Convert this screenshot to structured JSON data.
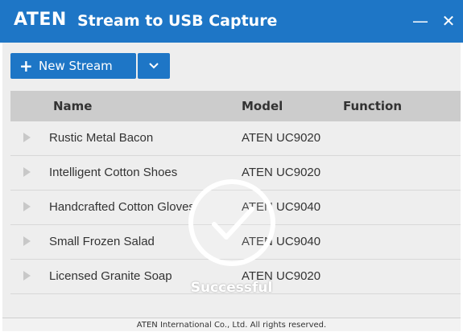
{
  "titlebar": {
    "logo": "ATEN",
    "title": "Stream to USB Capture",
    "minimize_glyph": "—",
    "close_glyph": "✕"
  },
  "toolbar": {
    "new_stream_label": "New Stream",
    "plus_glyph": "+"
  },
  "table": {
    "columns": [
      "Name",
      "Model",
      "Function"
    ],
    "rows": [
      {
        "name": "Rustic Metal Bacon",
        "model": "ATEN UC9020",
        "function": ""
      },
      {
        "name": "Intelligent Cotton Shoes",
        "model": "ATEN UC9020",
        "function": ""
      },
      {
        "name": "Handcrafted Cotton Gloves",
        "model": "ATEN UC9040",
        "function": ""
      },
      {
        "name": "Small Frozen Salad",
        "model": "ATEN UC9040",
        "function": ""
      },
      {
        "name": "Licensed Granite Soap",
        "model": "ATEN UC9020",
        "function": ""
      }
    ]
  },
  "overlay": {
    "status_text": "Successful",
    "icon": "checkmark-circle-icon"
  },
  "footer": {
    "copyright": "ATEN International Co., Ltd. All rights reserved."
  },
  "colors": {
    "accent": "#1e76c6",
    "header_bg": "#cccccc",
    "body_bg": "#eeeeee"
  }
}
